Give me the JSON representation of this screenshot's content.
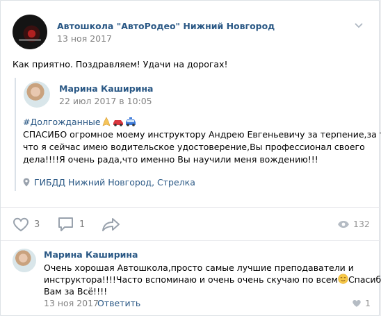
{
  "post": {
    "author": "Автошкола \"АвтоРодео\" Нижний Новгород",
    "date": "13 ноя 2017",
    "text": "Как приятно. Поздравляем! Удачи на дорогах!"
  },
  "repost": {
    "author": "Марина Каширина",
    "date": "22 июл 2017 в 10:05",
    "hashtag": "#Долгожданные",
    "line1": "СПАСИБО огромное моему инструктору Андрею Евгеньевичу за терпение,за то",
    "line2": "что я сейчас имею водительское удостоверение,Вы профессионал своего",
    "line3": "дела!!!!Я очень рада,что именно Вы научили меня вождению!!!",
    "location": "ГИБДД Нижний Новгород, Стрелка"
  },
  "actions": {
    "likes": "3",
    "comments": "1",
    "views": "132"
  },
  "comment": {
    "author": "Марина Каширина",
    "line1": "Очень хорошая Автошкола,просто самые лучшие преподаватели и",
    "line2": "инструктора!!!!Часто вспоминаю и очень очень скучаю по всем",
    "line2_tail": "Спасибо",
    "line3": "Вам за Всё!!!!",
    "date": "13 ноя 2017",
    "reply_label": "Ответить",
    "likes": "1"
  },
  "icons": [
    "chevron-down-icon",
    "pin-icon",
    "heart-icon",
    "comment-icon",
    "share-icon",
    "eye-icon",
    "prayer-emoji",
    "car-emoji",
    "police-car-emoji",
    "relieved-emoji"
  ]
}
